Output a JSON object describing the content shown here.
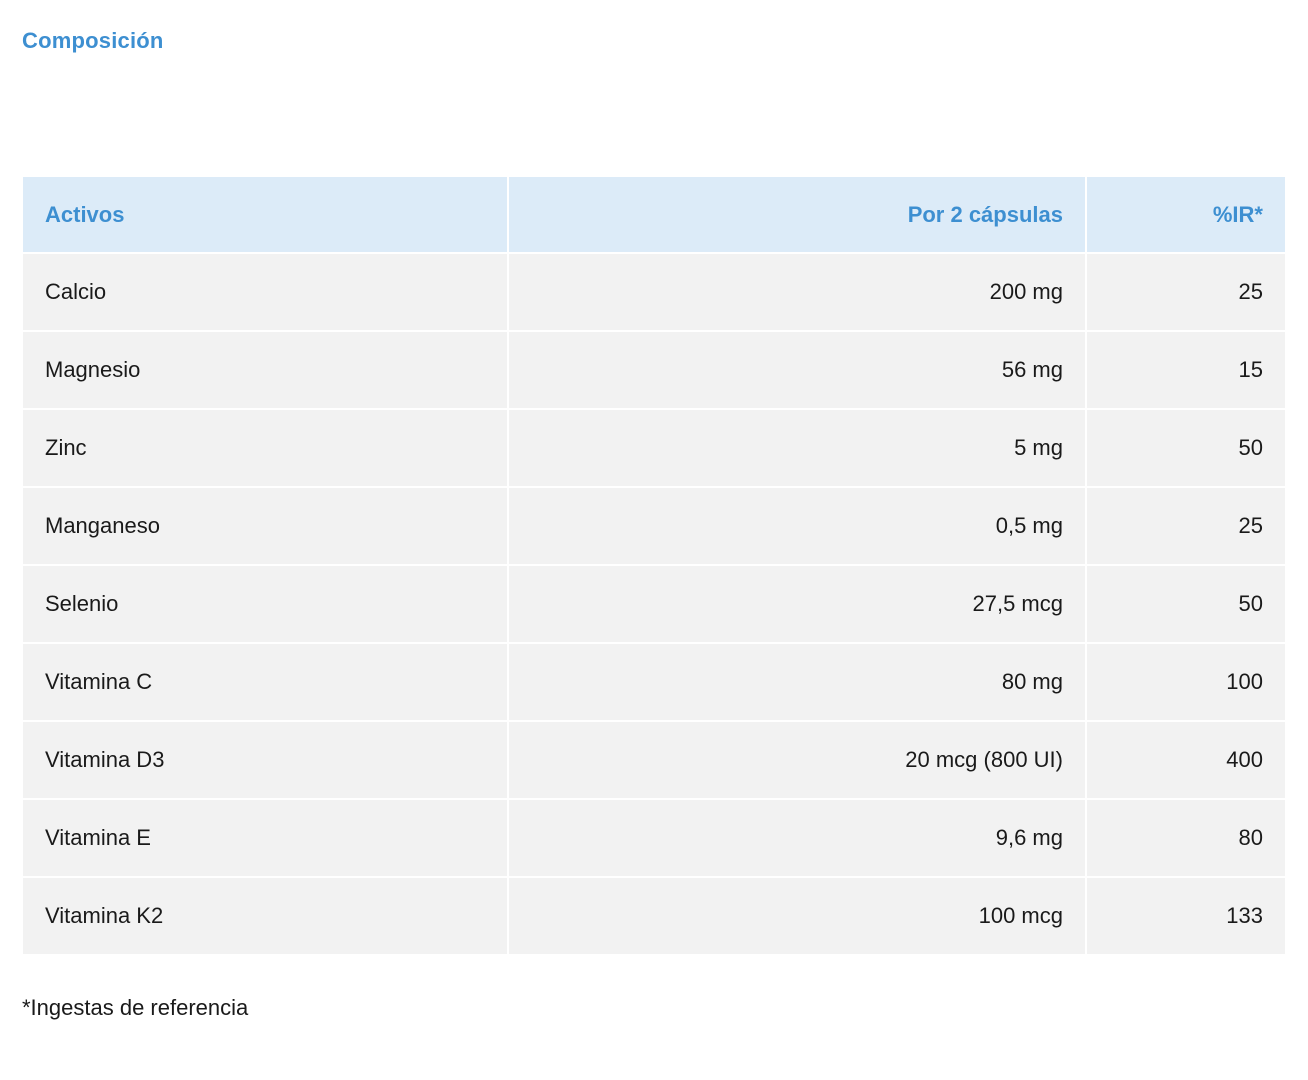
{
  "section_title": "Composición",
  "colors": {
    "accent": "#3d8fd1",
    "header_bg": "#dcebf8",
    "row_bg": "#f2f2f2"
  },
  "table": {
    "headers": [
      "Activos",
      "Por 2 cápsulas",
      "%IR*"
    ],
    "rows": [
      [
        "Calcio",
        "200 mg",
        "25"
      ],
      [
        "Magnesio",
        "56 mg",
        "15"
      ],
      [
        "Zinc",
        "5 mg",
        "50"
      ],
      [
        "Manganeso",
        "0,5 mg",
        "25"
      ],
      [
        "Selenio",
        "27,5 mcg",
        "50"
      ],
      [
        "Vitamina C",
        "80 mg",
        "100"
      ],
      [
        "Vitamina D3",
        "20 mcg (800 UI)",
        "400"
      ],
      [
        "Vitamina E",
        "9,6 mg",
        "80"
      ],
      [
        "Vitamina K2",
        "100 mcg",
        "133"
      ]
    ]
  },
  "footnote": "*Ingestas de referencia"
}
